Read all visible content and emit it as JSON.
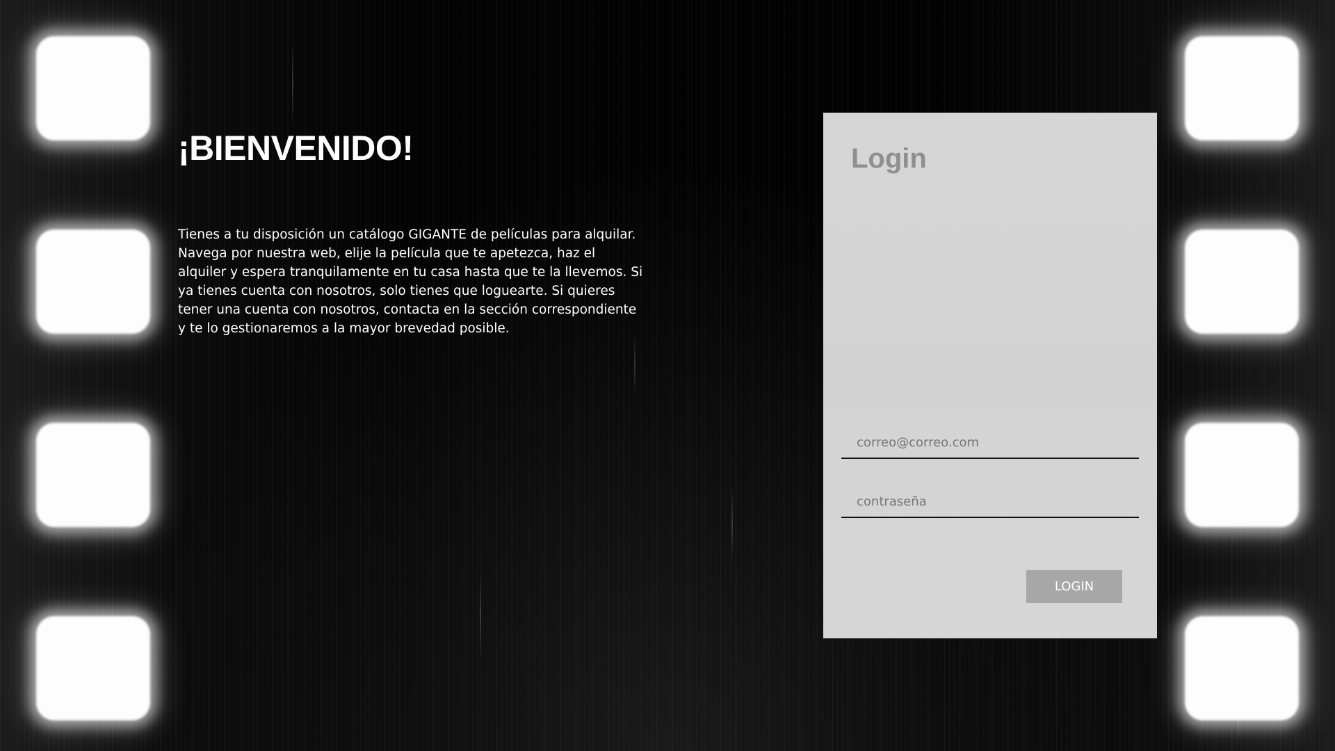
{
  "welcome": {
    "title": "¡BIENVENIDO!",
    "text": "Tienes a tu disposición un catálogo GIGANTE de películas para alquilar. Navega por nuestra web, elije la película que te apetezca, haz el alquiler y espera tranquilamente en tu casa hasta que te la llevemos. Si ya tienes cuenta con nosotros, solo tienes que loguearte. Si quieres tener una cuenta con nosotros, contacta en la sección correspondiente y te lo gestionaremos a la mayor brevedad posible."
  },
  "login": {
    "title": "Login",
    "email_placeholder": "correo@correo.com",
    "password_placeholder": "contraseña",
    "button_label": "LOGIN"
  },
  "colors": {
    "background": "#050505",
    "panel": "#d5d5d5",
    "panel_title": "#8f8f8f",
    "button": "#a7a7a7",
    "text": "#ffffff"
  }
}
